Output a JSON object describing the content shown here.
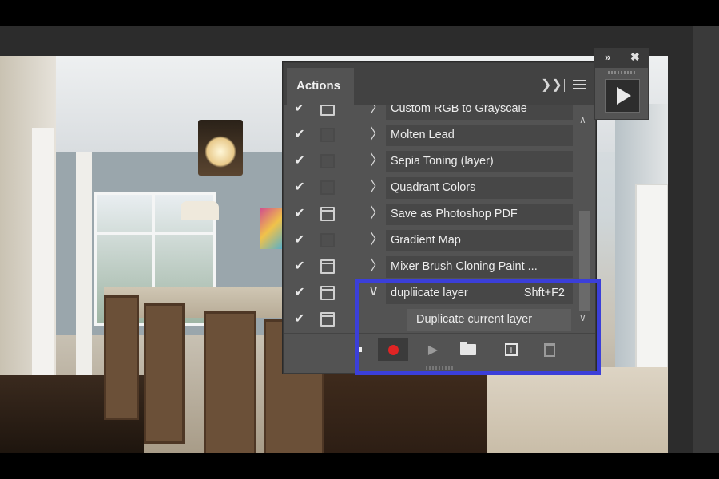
{
  "panel": {
    "tab_label": "Actions",
    "collapse_icon": "double-chevron-right-icon",
    "menu_icon": "hamburger-menu-icon"
  },
  "actions": [
    {
      "label": "Custom RGB to Grayscale",
      "checked": true,
      "dialog": "on",
      "shortcut": ""
    },
    {
      "label": "Molten Lead",
      "checked": true,
      "dialog": "off",
      "shortcut": ""
    },
    {
      "label": "Sepia Toning (layer)",
      "checked": true,
      "dialog": "off",
      "shortcut": ""
    },
    {
      "label": "Quadrant Colors",
      "checked": true,
      "dialog": "off",
      "shortcut": ""
    },
    {
      "label": "Save as Photoshop PDF",
      "checked": true,
      "dialog": "on",
      "shortcut": ""
    },
    {
      "label": "Gradient Map",
      "checked": true,
      "dialog": "off",
      "shortcut": ""
    },
    {
      "label": "Mixer Brush Cloning Paint ...",
      "checked": true,
      "dialog": "on",
      "shortcut": ""
    },
    {
      "label": "dupliicate layer",
      "checked": true,
      "dialog": "on",
      "shortcut": "Shft+F2",
      "expanded": true
    }
  ],
  "step": {
    "label": "Duplicate current layer",
    "checked": true,
    "dialog": "on"
  },
  "toolbar": {
    "stop_icon": "stop-icon",
    "record_icon": "record-icon",
    "play_icon": "play-icon",
    "folder_icon": "new-set-folder-icon",
    "new_icon": "new-action-icon",
    "trash_icon": "trash-icon",
    "record_color": "#e02424"
  },
  "mini_panel": {
    "collapse_icon": "double-chevron-right-icon",
    "close_icon": "close-icon",
    "play_icon": "play-icon"
  },
  "highlight_color": "#3b3fd9"
}
